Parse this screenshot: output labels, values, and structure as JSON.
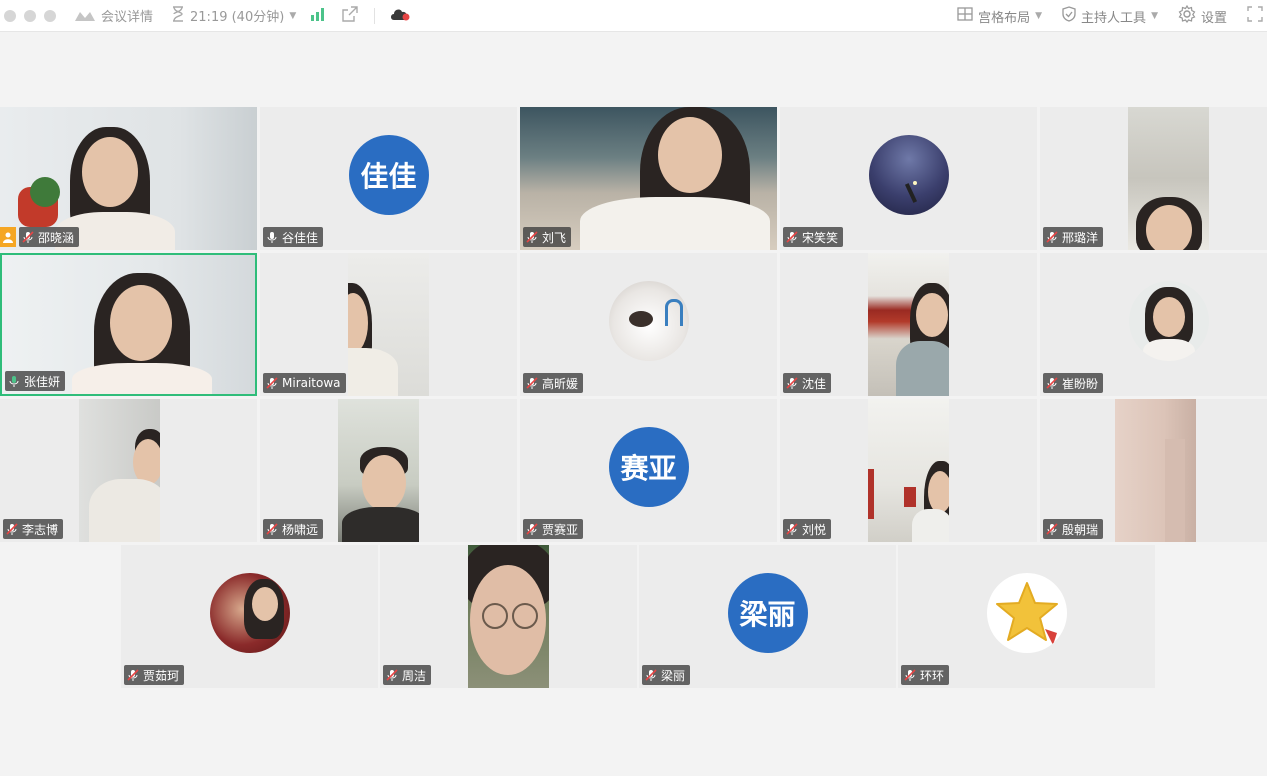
{
  "toolbar": {
    "meeting_info": "会议详情",
    "timer": "21:19 (40分钟)",
    "layout": "宫格布局",
    "host_tools": "主持人工具",
    "settings": "设置"
  },
  "colors": {
    "avatar_blue": "#2a6dc2",
    "speaking_border": "#2fbd7a",
    "host_badge": "#f5a623",
    "muted_slash": "#e64545"
  },
  "participants": [
    {
      "name": "邵晓涵",
      "type": "video",
      "muted": true,
      "host": true
    },
    {
      "name": "谷佳佳",
      "type": "avatar",
      "avatar_text": "佳佳",
      "muted": false
    },
    {
      "name": "刘飞",
      "type": "video",
      "muted": true
    },
    {
      "name": "宋笑笑",
      "type": "photo",
      "muted": true
    },
    {
      "name": "邢璐洋",
      "type": "video",
      "muted": true
    },
    {
      "name": "张佳妍",
      "type": "video",
      "muted": false,
      "speaking": true
    },
    {
      "name": "Miraitowa",
      "type": "video",
      "muted": true
    },
    {
      "name": "高昕媛",
      "type": "photo",
      "muted": true
    },
    {
      "name": "沈佳",
      "type": "video",
      "muted": true
    },
    {
      "name": "崔盼盼",
      "type": "photo",
      "muted": true
    },
    {
      "name": "李志博",
      "type": "video",
      "muted": true
    },
    {
      "name": "杨啸远",
      "type": "video",
      "muted": true
    },
    {
      "name": "贾赛亚",
      "type": "avatar",
      "avatar_text": "赛亚",
      "muted": true
    },
    {
      "name": "刘悦",
      "type": "video",
      "muted": true
    },
    {
      "name": "殷朝瑞",
      "type": "video",
      "muted": true
    },
    {
      "name": "贾茹珂",
      "type": "photo",
      "muted": true
    },
    {
      "name": "周洁",
      "type": "video",
      "muted": true
    },
    {
      "name": "梁丽",
      "type": "avatar",
      "avatar_text": "梁丽",
      "muted": true
    },
    {
      "name": "环环",
      "type": "photo",
      "muted": true
    }
  ]
}
